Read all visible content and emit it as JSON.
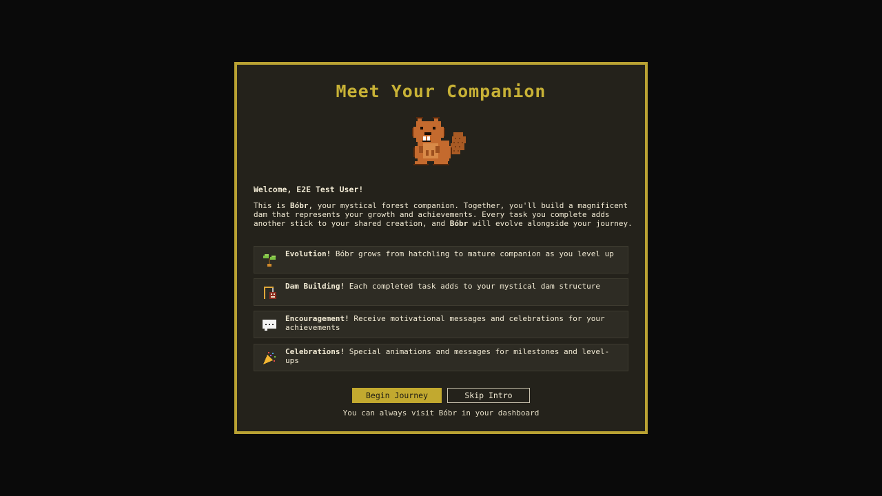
{
  "modal": {
    "title": "Meet Your Companion",
    "welcome": "Welcome, E2E Test User!",
    "intro": {
      "part1": "This is ",
      "name": "Bóbr",
      "part2": ", your mystical forest companion. Together, you'll build a magnificent dam that represents your growth and achievements. Every task you complete adds another stick to your shared creation, and ",
      "name2": "Bóbr",
      "part3": " will evolve alongside your journey."
    },
    "features": [
      {
        "icon": "seedling-icon",
        "label": "Evolution!",
        "text": " Bóbr grows from hatchling to mature companion as you level up"
      },
      {
        "icon": "construction-icon",
        "label": "Dam Building!",
        "text": " Each completed task adds to your mystical dam structure"
      },
      {
        "icon": "speech-bubble-icon",
        "label": "Encouragement!",
        "text": " Receive motivational messages and celebrations for your achievements"
      },
      {
        "icon": "party-popper-icon",
        "label": "Celebrations!",
        "text": " Special animations and messages for milestones and level-ups"
      }
    ],
    "buttons": {
      "begin": "Begin Journey",
      "skip": "Skip Intro"
    },
    "footnote": "You can always visit Bóbr in your dashboard"
  },
  "colors": {
    "accent": "#b9a233",
    "panel": "#24221b",
    "backdrop": "#0a0a0a",
    "text": "#f1ead4"
  }
}
